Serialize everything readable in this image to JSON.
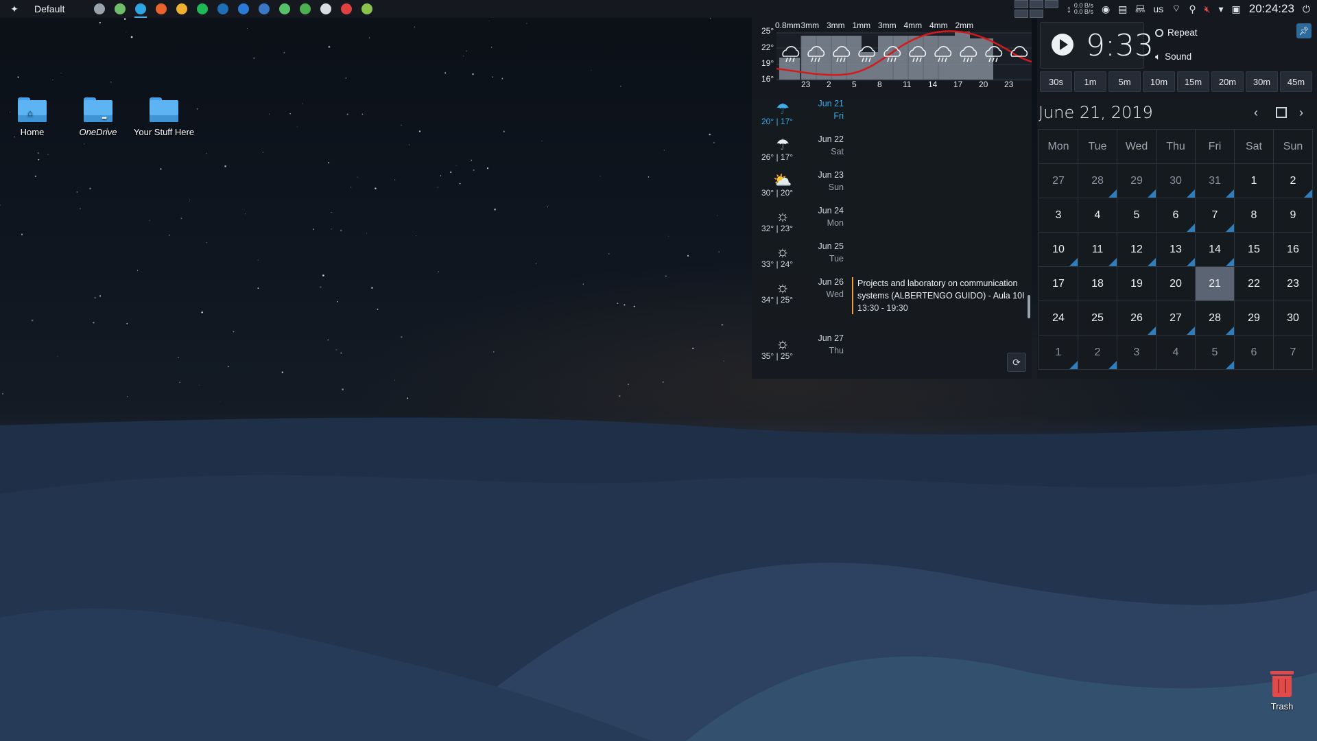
{
  "panel": {
    "activity": "Default",
    "clock": "20:24:23",
    "keyboard_layout": "us",
    "net_up": "0.0 B/s",
    "net_down": "0.0 B/s",
    "battery": "85%",
    "tasks": [
      {
        "icon": "terminal-icon",
        "color": "#9aa3ad"
      },
      {
        "icon": "archive-icon",
        "color": "#6fbf6a"
      },
      {
        "icon": "telegram-icon",
        "color": "#2ea6e6"
      },
      {
        "icon": "firefox-icon",
        "color": "#e8642a"
      },
      {
        "icon": "night-mode-icon",
        "color": "#f0b030"
      },
      {
        "icon": "spotify-icon",
        "color": "#1db954"
      },
      {
        "icon": "vscode-icon",
        "color": "#1f6fb8"
      },
      {
        "icon": "writer-icon",
        "color": "#2b7bd6"
      },
      {
        "icon": "qbittorrent-icon",
        "color": "#3a78c6"
      },
      {
        "icon": "android-icon",
        "color": "#56c26a"
      },
      {
        "icon": "image-viewer-icon",
        "color": "#4caf50"
      },
      {
        "icon": "settings-tool-icon",
        "color": "#d8dde3"
      },
      {
        "icon": "redshift-icon",
        "color": "#e04040"
      },
      {
        "icon": "uget-icon",
        "color": "#8bc34a"
      }
    ]
  },
  "desktop": {
    "icons": [
      {
        "label": "Home"
      },
      {
        "label": "OneDrive"
      },
      {
        "label": "Your Stuff Here"
      }
    ],
    "trash_label": "Trash"
  },
  "weather": {
    "y_labels": [
      "25°",
      "22°",
      "19°",
      "16°"
    ],
    "precip_labels": [
      "0.8mm",
      "3mm",
      "3mm",
      "1mm",
      "3mm",
      "4mm",
      "4mm",
      "2mm"
    ],
    "hour_labels": [
      "23",
      "2",
      "5",
      "8",
      "11",
      "14",
      "17",
      "20",
      "23"
    ],
    "days": [
      {
        "date": "Jun 21",
        "dow": "Fri",
        "temps": "20° | 17°",
        "icon": "rain-icon"
      },
      {
        "date": "Jun 22",
        "dow": "Sat",
        "temps": "26° | 17°",
        "icon": "rain-icon"
      },
      {
        "date": "Jun 23",
        "dow": "Sun",
        "temps": "30° | 20°",
        "icon": "partly-cloudy-icon"
      },
      {
        "date": "Jun 24",
        "dow": "Mon",
        "temps": "32° | 23°",
        "icon": "sun-icon"
      },
      {
        "date": "Jun 25",
        "dow": "Tue",
        "temps": "33° | 24°",
        "icon": "sun-icon"
      },
      {
        "date": "Jun 26",
        "dow": "Wed",
        "temps": "34° | 25°",
        "icon": "sun-icon"
      },
      {
        "date": "Jun 27",
        "dow": "Thu",
        "temps": "35° | 25°",
        "icon": "sun-icon"
      }
    ],
    "event": {
      "title": "Projects and laboratory on communication systems (ALBERTENGO GUIDO)  - Aula 10I",
      "time": "13:30 - 19:30",
      "color": "#f0a030"
    }
  },
  "timer": {
    "time": "9:33",
    "repeat_label": "Repeat",
    "sound_label": "Sound",
    "presets": [
      "30s",
      "1m",
      "5m",
      "10m",
      "15m",
      "20m",
      "30m",
      "45m"
    ]
  },
  "calendar": {
    "title": "June 21, 2019",
    "weekdays": [
      "Mon",
      "Tue",
      "Wed",
      "Thu",
      "Fri",
      "Sat",
      "Sun"
    ],
    "today": "21",
    "weeks": [
      [
        "27",
        "28",
        "29",
        "30",
        "31",
        "1",
        "2"
      ],
      [
        "3",
        "4",
        "5",
        "6",
        "7",
        "8",
        "9"
      ],
      [
        "10",
        "11",
        "12",
        "13",
        "14",
        "15",
        "16"
      ],
      [
        "17",
        "18",
        "19",
        "20",
        "21",
        "22",
        "23"
      ],
      [
        "24",
        "25",
        "26",
        "27",
        "28",
        "29",
        "30"
      ],
      [
        "1",
        "2",
        "3",
        "4",
        "5",
        "6",
        "7"
      ]
    ],
    "muted": [
      [
        0,
        0
      ],
      [
        0,
        1
      ],
      [
        0,
        2
      ],
      [
        0,
        3
      ],
      [
        0,
        4
      ],
      [
        5,
        0
      ],
      [
        5,
        1
      ],
      [
        5,
        2
      ],
      [
        5,
        3
      ],
      [
        5,
        4
      ],
      [
        5,
        5
      ],
      [
        5,
        6
      ]
    ],
    "events": [
      [
        0,
        1
      ],
      [
        0,
        2
      ],
      [
        0,
        3
      ],
      [
        0,
        4
      ],
      [
        0,
        6
      ],
      [
        1,
        3
      ],
      [
        1,
        4
      ],
      [
        2,
        0
      ],
      [
        2,
        1
      ],
      [
        2,
        2
      ],
      [
        2,
        3
      ],
      [
        2,
        4
      ],
      [
        4,
        2
      ],
      [
        4,
        3
      ],
      [
        4,
        4
      ],
      [
        5,
        0
      ],
      [
        5,
        1
      ],
      [
        5,
        4
      ]
    ],
    "accent": "#2f7dbd"
  }
}
